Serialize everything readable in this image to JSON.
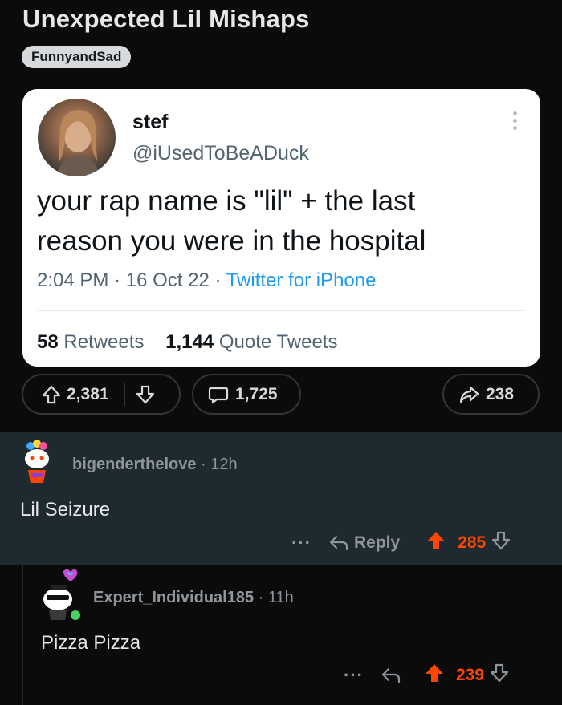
{
  "post": {
    "title": "Unexpected Lil Mishaps",
    "flair": "FunnyandSad"
  },
  "tweet": {
    "name": "stef",
    "handle": "@iUsedToBeADuck",
    "text_line1": "your rap name is \"lil\" + the last",
    "text_line2": "reason you were in the hospital",
    "time": "2:04 PM",
    "date": "16 Oct 22",
    "source": "Twitter for iPhone",
    "retweets_count": "58",
    "retweets_label": "Retweets",
    "quotes_count": "1,144",
    "quotes_label": "Quote Tweets"
  },
  "actions": {
    "upvotes": "2,381",
    "comments": "1,725",
    "shares": "238"
  },
  "comments": [
    {
      "username": "bigenderthelove",
      "age": "12h",
      "body": "Lil Seizure",
      "more": "···",
      "reply_label": "Reply",
      "score": "285"
    },
    {
      "username": "Expert_Individual185",
      "age": "11h",
      "body": "Pizza Pizza",
      "more": "···",
      "score": "239"
    }
  ],
  "colors": {
    "upvote_active": "#ff4500",
    "tweet_link": "#1d9bf0",
    "comment_bg": "#1f2a30",
    "online_dot": "#46d160"
  },
  "icons": [
    "upvote-icon",
    "downvote-icon",
    "comment-icon",
    "share-icon",
    "reply-icon",
    "more-icon"
  ]
}
